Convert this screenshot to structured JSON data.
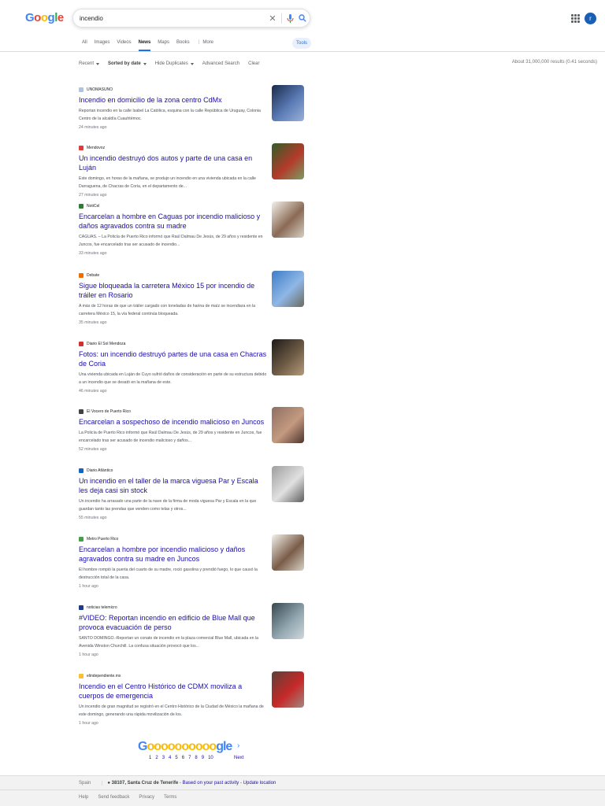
{
  "header": {
    "logo": [
      "G",
      "o",
      "o",
      "g",
      "l",
      "e"
    ],
    "search_value": "incendio",
    "avatar_letter": "r"
  },
  "tabs": [
    {
      "label": "All",
      "active": false
    },
    {
      "label": "Images",
      "active": false
    },
    {
      "label": "Videos",
      "active": false
    },
    {
      "label": "News",
      "active": true
    },
    {
      "label": "Maps",
      "active": false
    },
    {
      "label": "Books",
      "active": false
    },
    {
      "label": "⋮ More",
      "active": false
    }
  ],
  "tools_label": "Tools",
  "filters": {
    "recent": "Recent",
    "sorted": "Sorted by date",
    "duplicates": "Hide Duplicates",
    "advanced": "Advanced Search",
    "clear": "Clear"
  },
  "results_count": "About 31,000,000 results (0.41 seconds)",
  "results": [
    {
      "source": "UNOMASUNO",
      "favicon_color": "#b0c4de",
      "title": "Incendio en domicilio de la zona centro CdMx",
      "snippet": "Reportan incendio en la calle Isabel La Católica, esquina con la calle República de Uruguay, Colonia Centro de la alcaldía Cuauhtémoc.",
      "time": "24 minutes ago",
      "thumb_colors": [
        "#1b2a4a",
        "#5a7bb5",
        "#9bb0d9"
      ]
    },
    {
      "source": "Mendovoz",
      "favicon_color": "#e53935",
      "title": "Un incendio destruyó dos autos y parte de una casa en Luján",
      "snippet": "Este domingo, en horas de la mañana, se produjo un incendio en una vivienda ubicada en la calle Darraguena, de Chacras de Coria, en el departamento de...",
      "time": "27 minutes ago",
      "thumb_colors": [
        "#2e5e2a",
        "#b33a2a",
        "#7c9c64"
      ]
    },
    {
      "source": "NotiCel",
      "favicon_color": "#2e7d32",
      "title": "Encarcelan a hombre en Caguas por incendio malicioso y daños agravados contra su madre",
      "snippet": "CAGUAS. – La Policía de Puerto Rico informó que Raúl Dalmau De Jesús, de 29 años y residente en Juncos, fue encarcelado tras ser acusado de incendio...",
      "time": "33 minutes ago",
      "thumb_colors": [
        "#f4f1ea",
        "#8b6a55",
        "#d6cfc2"
      ]
    },
    {
      "source": "Debate",
      "favicon_color": "#ef6c00",
      "title": "Sigue bloqueada la carretera México 15 por incendio de tráiler en Rosario",
      "snippet": "A más de 12 horas de que un tráiler cargado con toneladas de harina de maíz se incendiara en la carretera México 15, la vía federal continúa bloqueada.",
      "time": "35 minutes ago",
      "thumb_colors": [
        "#3f7cc8",
        "#8fb7e6",
        "#6b6b5e"
      ]
    },
    {
      "source": "Diario El Sol Mendoza",
      "favicon_color": "#d32f2f",
      "title": "Fotos: un incendio destruyó partes de una casa en Chacras de Coria",
      "snippet": "Una vivienda ubicada en Luján de Cuyo sufrió daños de consideración en parte de su estructura debido a un incendio que se desató en la mañana de este.",
      "time": "46 minutes ago",
      "thumb_colors": [
        "#1d1a17",
        "#6e5b45",
        "#b49a7a"
      ]
    },
    {
      "source": "El Vocero de Puerto Rico",
      "favicon_color": "#424242",
      "title": "Encarcelan a sospechoso de incendio malicioso en Juncos",
      "snippet": "La Policía de Puerto Rico informó que Raúl Dalmau De Jesús, de 29 años y residente en Juncos, fue encarcelado tras ser acusado de incendio malicioso y daños...",
      "time": "52 minutes ago",
      "thumb_colors": [
        "#8d6e63",
        "#c49a80",
        "#4e342e"
      ]
    },
    {
      "source": "Diario Atlántico",
      "favicon_color": "#1565c0",
      "title": "Un incendio en el taller de la marca viguesa Par y Escala les deja casi sin stock",
      "snippet": "Un incendio ha arrasado una parte de la nave de la firma de moda viguesa Par y Escala en la que guardan tanto las prendas que venden como telas y otros...",
      "time": "55 minutes ago",
      "thumb_colors": [
        "#9e9e9e",
        "#e0e0e0",
        "#5d5d5d"
      ]
    },
    {
      "source": "Metro Puerto Rico",
      "favicon_color": "#43a047",
      "title": "Encarcelan a hombre por incendio malicioso y daños agravados contra su madre en Juncos",
      "snippet": "El hombre rompió la puerta del cuarto de su madre, roció gasolina y prendió fuego, lo que causó la destrucción total de la casa.",
      "time": "1 hour ago",
      "thumb_colors": [
        "#f5f2ec",
        "#7a5c48",
        "#d8d2c6"
      ]
    },
    {
      "source": "noticias telemicro",
      "favicon_color": "#1e3a8a",
      "title": "#VIDEO: Reportan incendio en edificio de Blue Mall que provoca evacuación de perso",
      "snippet": "SANTO DOMINGO.-Reportan un conato de incendio en la plaza comercial Blue Mall, ubicada en la Avenida Winston Churchill. La confusa situación provocó que los...",
      "time": "1 hour ago",
      "thumb_colors": [
        "#37474f",
        "#90a4ae",
        "#cfd8dc"
      ]
    },
    {
      "source": "elindependiente.mx",
      "favicon_color": "#fbc02d",
      "title": "Incendio en el Centro Histórico de CDMX moviliza a cuerpos de emergencia",
      "snippet": "Un incendio de gran magnitud se registró en el Centro Histórico de la Ciudad de México la mañana de este domingo, generando una rápida movilización de los.",
      "time": "1 hour ago",
      "thumb_colors": [
        "#5d4037",
        "#c62828",
        "#a1887f"
      ]
    }
  ],
  "pagination": {
    "logo_start": "G",
    "logo_middle": "oooooooooo",
    "logo_end": "gle",
    "pages": [
      "1",
      "2",
      "3",
      "4",
      "5",
      "6",
      "7",
      "8",
      "9",
      "10"
    ],
    "next": "Next"
  },
  "footer": {
    "country": "Spain",
    "location": "38107, Santa Cruz de Tenerife",
    "based_on": "Based on your past activity",
    "update": "Update location",
    "links": [
      "Help",
      "Send feedback",
      "Privacy",
      "Terms"
    ]
  }
}
